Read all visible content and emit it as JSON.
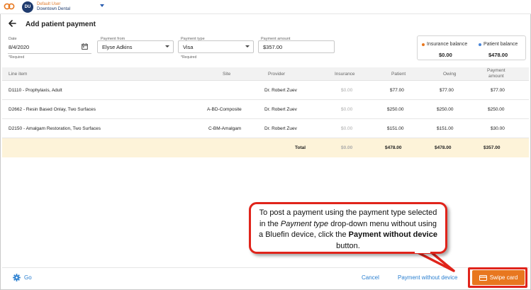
{
  "topbar": {
    "avatar_initials": "DU",
    "user_name": "Default User",
    "practice_name": "Downtown Dental"
  },
  "header": {
    "title": "Add patient payment"
  },
  "form": {
    "date_label": "Date",
    "date_value": "8/4/2020",
    "date_required": "*Required",
    "payment_from_label": "Payment from",
    "payment_from_value": "Elyse Adkins",
    "payment_type_label": "Payment type",
    "payment_type_value": "Visa",
    "payment_type_required": "*Required",
    "payment_amount_label": "Payment amount",
    "payment_amount_value": "$357.00"
  },
  "balances": {
    "insurance_label": "Insurance balance",
    "insurance_value": "$0.00",
    "insurance_color": "#e8771f",
    "patient_label": "Patient balance",
    "patient_value": "$478.00",
    "patient_color": "#4a86d8"
  },
  "table": {
    "headers": {
      "line_item": "Line item",
      "site": "Site",
      "provider": "Provider",
      "insurance": "Insurance",
      "patient": "Patient",
      "owing": "Owing",
      "payment_amount_1": "Payment",
      "payment_amount_2": "amount"
    },
    "rows": [
      {
        "line_item": "D1110 - Prophylaxis, Adult",
        "site": "",
        "provider": "Dr. Robert Zuev",
        "insurance": "$0.00",
        "patient": "$77.00",
        "owing": "$77.00",
        "payment": "$77.00"
      },
      {
        "line_item": "D2662 - Resin Based Onlay, Two Surfaces",
        "site": "A-BD-Composite",
        "provider": "Dr. Robert Zuev",
        "insurance": "$0.00",
        "patient": "$250.00",
        "owing": "$250.00",
        "payment": "$250.00"
      },
      {
        "line_item": "D2150 - Amalgam Restoration, Two Surfaces",
        "site": "C-BM-Amalgam",
        "provider": "Dr. Robert Zuev",
        "insurance": "$0.00",
        "patient": "$151.00",
        "owing": "$151.00",
        "payment": "$30.00"
      }
    ],
    "total": {
      "label": "Total",
      "insurance": "$0.00",
      "patient": "$478.00",
      "owing": "$478.00",
      "payment": "$357.00"
    }
  },
  "footer": {
    "go_label": "Go",
    "cancel_label": "Cancel",
    "payment_without_device_label": "Payment without device",
    "swipe_card_label": "Swipe card"
  },
  "callout": {
    "part1": "To post a payment using the payment type selected in the ",
    "part2_italic": "Payment type",
    "part3": " drop-down menu without using a Bluefin device, click the ",
    "part4_bold": "Payment without device",
    "part5": " button."
  },
  "colors": {
    "accent_orange": "#e8771f",
    "link_blue": "#2a7fd0",
    "callout_red": "#e0241b",
    "total_row_bg": "#fdf3d9"
  }
}
